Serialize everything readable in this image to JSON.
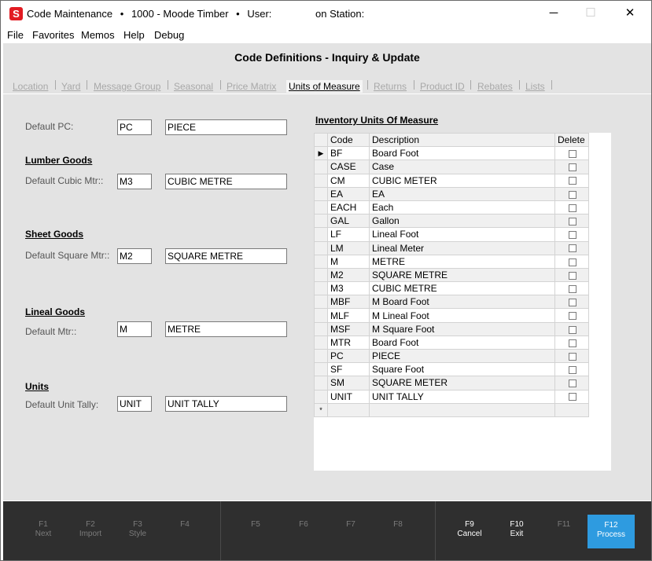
{
  "titlebar": {
    "app_icon": "S",
    "app_name": "Code Maintenance",
    "company": "1000 - Moode Timber",
    "user_label": "User:",
    "station_label": "on Station:",
    "separator": "•"
  },
  "menu": [
    "File",
    "Favorites",
    "Memos",
    "Help",
    "Debug"
  ],
  "page_title": "Code Definitions - Inquiry & Update",
  "tabs": [
    "Location",
    "Yard",
    "Message Group",
    "Seasonal",
    "Price Matrix",
    "Units of Measure",
    "Returns",
    "Product ID",
    "Rebates",
    "Lists"
  ],
  "active_tab": "Units of Measure",
  "form": {
    "default_pc": {
      "label": "Default PC:",
      "code": "PC",
      "desc": "PIECE"
    },
    "lumber": {
      "heading": "Lumber Goods",
      "label": "Default Cubic Mtr::",
      "code": "M3",
      "desc": "CUBIC METRE"
    },
    "sheet": {
      "heading": "Sheet Goods",
      "label": "Default Square Mtr::",
      "code": "M2",
      "desc": "SQUARE METRE"
    },
    "lineal": {
      "heading": "Lineal Goods",
      "label": "Default  Mtr::",
      "code": "M",
      "desc": "METRE"
    },
    "units": {
      "heading": "Units",
      "label": "Default Unit Tally:",
      "code": "UNIT",
      "desc": "UNIT TALLY"
    }
  },
  "grid": {
    "title": "Inventory Units Of Measure",
    "headers": {
      "code": "Code",
      "description": "Description",
      "delete": "Delete"
    },
    "current_row_marker": "▶",
    "new_row_marker": "*",
    "rows": [
      {
        "code": "BF",
        "description": "Board Foot"
      },
      {
        "code": "CASE",
        "description": "Case"
      },
      {
        "code": "CM",
        "description": "CUBIC METER"
      },
      {
        "code": "EA",
        "description": "EA"
      },
      {
        "code": "EACH",
        "description": "Each"
      },
      {
        "code": "GAL",
        "description": "Gallon"
      },
      {
        "code": "LF",
        "description": "Lineal Foot"
      },
      {
        "code": "LM",
        "description": "Lineal Meter"
      },
      {
        "code": "M",
        "description": "METRE"
      },
      {
        "code": "M2",
        "description": "SQUARE METRE"
      },
      {
        "code": "M3",
        "description": "CUBIC METRE"
      },
      {
        "code": "MBF",
        "description": "M Board Foot"
      },
      {
        "code": "MLF",
        "description": "M Lineal Foot"
      },
      {
        "code": "MSF",
        "description": "M Square Foot"
      },
      {
        "code": "MTR",
        "description": "Board Foot"
      },
      {
        "code": "PC",
        "description": "PIECE"
      },
      {
        "code": "SF",
        "description": "Square Foot"
      },
      {
        "code": "SM",
        "description": "SQUARE METER"
      },
      {
        "code": "UNIT",
        "description": "UNIT TALLY"
      }
    ]
  },
  "fkeys": [
    {
      "key": "F1",
      "label": "Next",
      "enabled": false
    },
    {
      "key": "F2",
      "label": "Import",
      "enabled": false
    },
    {
      "key": "F3",
      "label": "Style",
      "enabled": false
    },
    {
      "key": "F4",
      "label": "",
      "enabled": false
    },
    {
      "key": "F5",
      "label": "",
      "enabled": false
    },
    {
      "key": "F6",
      "label": "",
      "enabled": false
    },
    {
      "key": "F7",
      "label": "",
      "enabled": false
    },
    {
      "key": "F8",
      "label": "",
      "enabled": false
    },
    {
      "key": "F9",
      "label": "Cancel",
      "enabled": true
    },
    {
      "key": "F10",
      "label": "Exit",
      "enabled": true
    },
    {
      "key": "F11",
      "label": "",
      "enabled": false
    },
    {
      "key": "F12",
      "label": "Process",
      "enabled": true,
      "primary": true
    }
  ],
  "colors": {
    "content_bg": "#e3e3e3",
    "fkey_bar": "#2f2f2f",
    "primary_key": "#2e9be0",
    "logo": "#e21b22"
  }
}
